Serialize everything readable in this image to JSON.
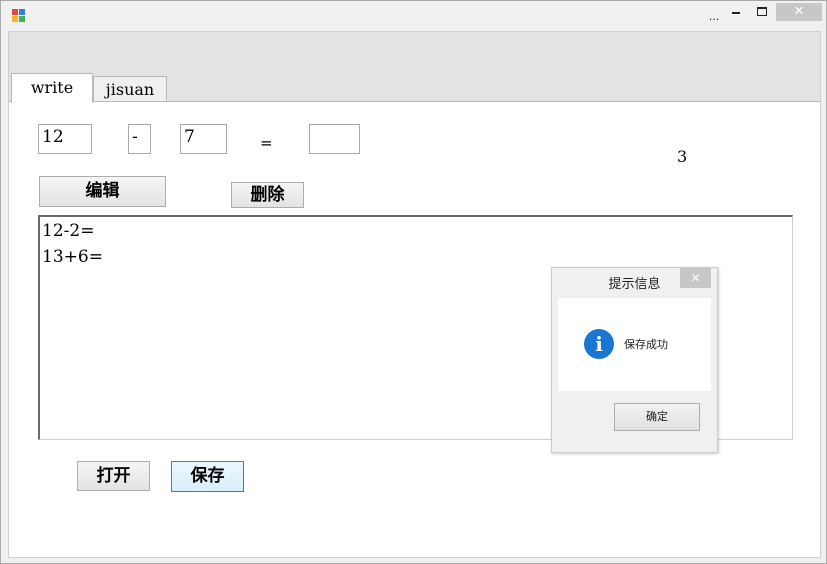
{
  "titlebar": {
    "dots": "...",
    "close_glyph": "✕"
  },
  "tabs": [
    {
      "label": "write",
      "active": true
    },
    {
      "label": "jisuan",
      "active": false
    }
  ],
  "form": {
    "operand1": "12",
    "operator": "-",
    "operand2": "7",
    "equals": "=",
    "answer": "",
    "result_label": "3",
    "edit_label": "编辑",
    "delete_label": "删除",
    "open_label": "打开",
    "save_label": "保存"
  },
  "content": {
    "lines": [
      "12-2=",
      "13+6="
    ]
  },
  "dialog": {
    "title": "提示信息",
    "message": "保存成功",
    "ok_label": "确定",
    "close_glyph": "✕",
    "icon_glyph": "i"
  },
  "colors": {
    "info_icon": "#1976d2",
    "save_border": "#3c7fb1",
    "close_button_bg": "#c7c7c7"
  }
}
